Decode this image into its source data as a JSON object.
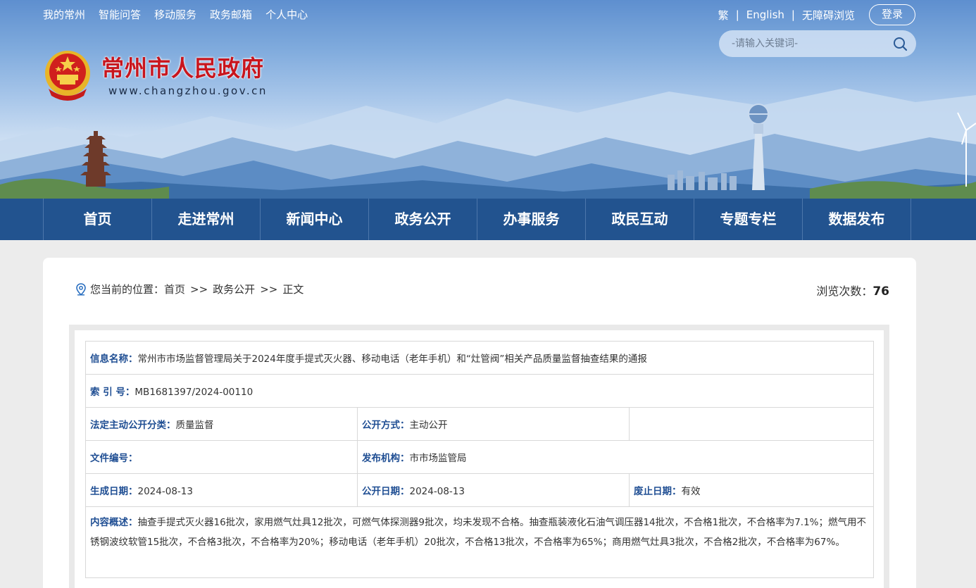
{
  "top_links": [
    "我的常州",
    "智能问答",
    "移动服务",
    "政务邮箱",
    "个人中心"
  ],
  "toolbar": {
    "traditional": "繁",
    "english": "English",
    "accessible": "无障碍浏览",
    "separator": "|",
    "login": "登录"
  },
  "search": {
    "placeholder": "-请输入关键词-"
  },
  "site": {
    "title": "常州市人民政府",
    "url": "www.changzhou.gov.cn"
  },
  "main_nav": [
    "首页",
    "走进常州",
    "新闻中心",
    "政务公开",
    "办事服务",
    "政民互动",
    "专题专栏",
    "数据发布"
  ],
  "breadcrumb": {
    "label": "您当前的位置：",
    "items": [
      "首页",
      "政务公开",
      "正文"
    ],
    "sep": ">>"
  },
  "views": {
    "label": "浏览次数：",
    "count": "76"
  },
  "info": {
    "name_k": "信息名称：",
    "name_v": "常州市市场监督管理局关于2024年度手提式灭火器、移动电话（老年手机）和“灶管阀”相关产品质量监督抽查结果的通报",
    "index_k": "索 引 号：",
    "index_v": "MB1681397/2024-00110",
    "category_k": "法定主动公开分类：",
    "category_v": "质量监督",
    "method_k": "公开方式：",
    "method_v": "主动公开",
    "docno_k": "文件编号：",
    "docno_v": "",
    "publisher_k": "发布机构：",
    "publisher_v": "市市场监管局",
    "created_k": "生成日期：",
    "created_v": "2024-08-13",
    "published_k": "公开日期：",
    "published_v": "2024-08-13",
    "expiry_k": "废止日期：",
    "expiry_v": "有效",
    "summary_k": "内容概述：",
    "summary_v": "抽查手提式灭火器16批次，家用燃气灶具12批次，可燃气体探测器9批次，均未发现不合格。抽查瓶装液化石油气调压器14批次，不合格1批次，不合格率为7.1%；燃气用不锈钢波纹软管15批次，不合格3批次，不合格率为20%；移动电话（老年手机）20批次，不合格13批次，不合格率为65%；商用燃气灶具3批次，不合格2批次，不合格率为67%。"
  },
  "colors": {
    "nav_bg": "#22538f",
    "title_red": "#c8151d",
    "label_blue": "#1f4e93"
  }
}
